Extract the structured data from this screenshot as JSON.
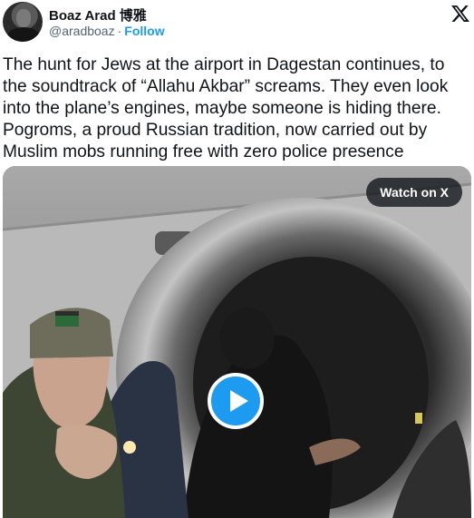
{
  "author": {
    "display_name": "Boaz Arad 博雅",
    "handle": "@aradboaz",
    "separator": "·",
    "follow_label": "Follow"
  },
  "tweet": {
    "text": "The hunt for Jews at the airport in Dagestan continues, to the soundtrack of “Allahu Akbar” screams. They even look into the plane’s engines, maybe someone is hiding there. Pogroms, a proud Russian tradition, now carried out by Muslim mobs running free with zero police presence"
  },
  "media": {
    "watch_label": "Watch on X",
    "play_icon": "play-icon"
  },
  "icons": {
    "platform_logo": "x-logo-icon",
    "avatar": "avatar"
  },
  "colors": {
    "accent": "#1d9bf0",
    "text": "#0f1419",
    "muted": "#536471"
  }
}
